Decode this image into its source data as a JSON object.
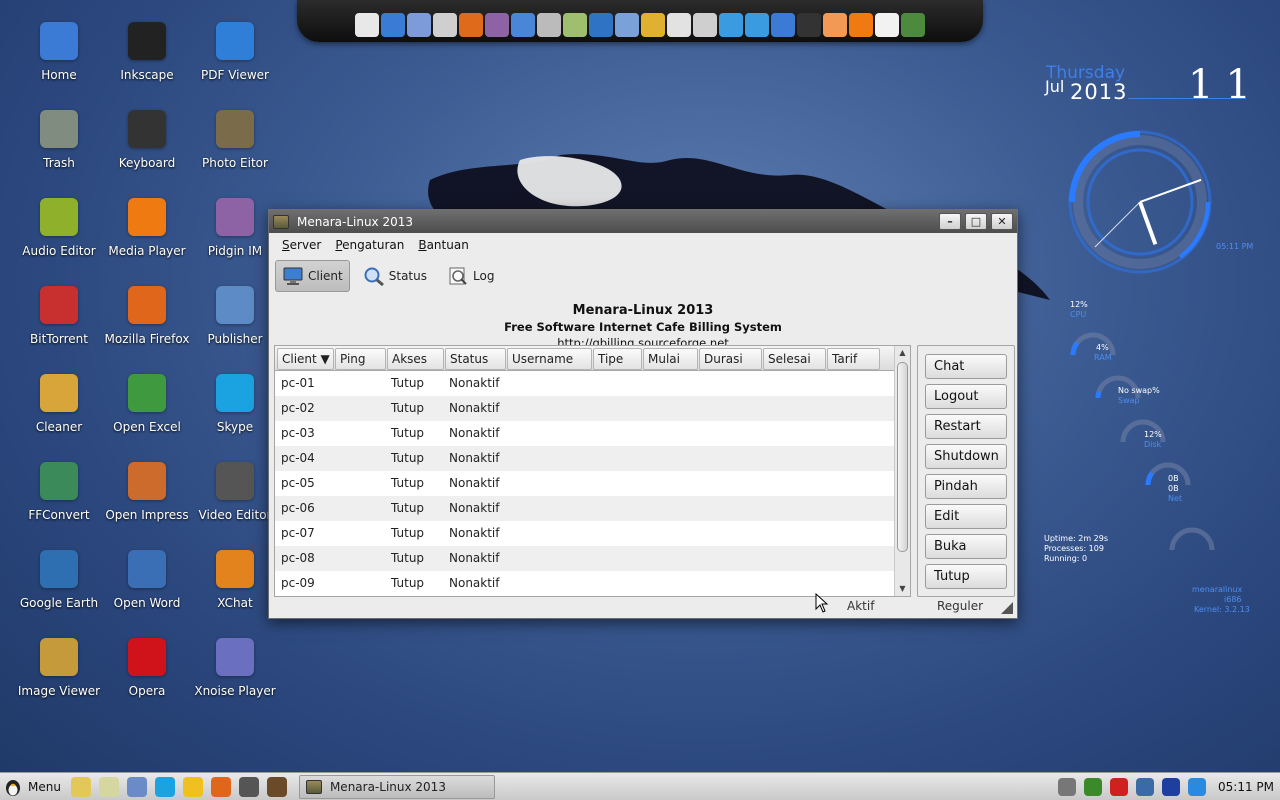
{
  "desktop": {
    "icons": [
      {
        "label": "Home",
        "icon": "home-icon",
        "color": "#3b7bd6"
      },
      {
        "label": "Inkscape",
        "icon": "inkscape-icon",
        "color": "#222222"
      },
      {
        "label": "PDF Viewer",
        "icon": "pdf-icon",
        "color": "#2f7fd8"
      },
      {
        "label": "Trash",
        "icon": "trash-icon",
        "color": "#7f8c7f"
      },
      {
        "label": "Keyboard",
        "icon": "keyboard-icon",
        "color": "#333333"
      },
      {
        "label": "Photo Eitor",
        "icon": "gimp-icon",
        "color": "#7a6b4a"
      },
      {
        "label": "Audio Editor",
        "icon": "music-note-icon",
        "color": "#8fb02a"
      },
      {
        "label": "Media Player",
        "icon": "vlc-cone-icon",
        "color": "#f07a12"
      },
      {
        "label": "Pidgin IM",
        "icon": "pidgin-icon",
        "color": "#8e63a6"
      },
      {
        "label": "BitTorrent",
        "icon": "torrent-icon",
        "color": "#c83030"
      },
      {
        "label": "Mozilla Firefox",
        "icon": "firefox-icon",
        "color": "#e0661c"
      },
      {
        "label": "Publisher",
        "icon": "publisher-icon",
        "color": "#5d8bc6"
      },
      {
        "label": "Cleaner",
        "icon": "broom-icon",
        "color": "#d7a53a"
      },
      {
        "label": "Open Excel",
        "icon": "spreadsheet-icon",
        "color": "#3f9a3f"
      },
      {
        "label": "Skype",
        "icon": "skype-icon",
        "color": "#1aa3e0"
      },
      {
        "label": "FFConvert",
        "icon": "film-convert-icon",
        "color": "#3a8a5a"
      },
      {
        "label": "Open Impress",
        "icon": "presentation-icon",
        "color": "#cc6b2c"
      },
      {
        "label": "Video Editor",
        "icon": "clapperboard-icon",
        "color": "#555555"
      },
      {
        "label": "Google Earth",
        "icon": "globe-icon",
        "color": "#2d6fb0"
      },
      {
        "label": "Open Word",
        "icon": "document-icon",
        "color": "#3b6fb5"
      },
      {
        "label": "XChat",
        "icon": "xchat-icon",
        "color": "#e2831d"
      },
      {
        "label": "Image Viewer",
        "icon": "image-icon",
        "color": "#c59a3a"
      },
      {
        "label": "Opera",
        "icon": "opera-icon",
        "color": "#d0121b"
      },
      {
        "label": "Xnoise Player",
        "icon": "xnoise-icon",
        "color": "#6a6fc0"
      }
    ]
  },
  "dock": {
    "items": [
      "printer-icon",
      "accessibility-icon",
      "calculator-icon",
      "disc-icon",
      "firefox-icon",
      "pidgin-icon",
      "home-icon",
      "copy-icon",
      "download-folder-icon",
      "monitor-icon",
      "search-icon",
      "bug-icon",
      "ftp-icon",
      "archive-download-icon",
      "dropbox-icon",
      "dropbox-icon",
      "help-icon",
      "terminal-icon",
      "shell-icon",
      "vlc-cone-icon",
      "disk-icon",
      "app-icon"
    ],
    "colors": [
      "#e8e8e8",
      "#3a7bd5",
      "#7d9bd8",
      "#cfcfcf",
      "#e06a1c",
      "#8e63a6",
      "#4a86d8",
      "#bbbbbb",
      "#9fbf6f",
      "#2f73c5",
      "#7aa2d9",
      "#e0b030",
      "#e2e2e2",
      "#cfcfcf",
      "#3b9be0",
      "#3b9be0",
      "#3b7bd6",
      "#333333",
      "#f29a55",
      "#f07a12",
      "#f2f2f2",
      "#4e8a3e"
    ]
  },
  "conky": {
    "day": "Thursday",
    "month": "Jul",
    "year": "2013",
    "date": "11",
    "time_small": "05:11 PM",
    "cpu_pct": "12%",
    "cpu_label": "CPU",
    "ram_pct": "4%",
    "ram_label": "RAM",
    "swap_pct": "No swap%",
    "swap_label": "Swap",
    "disk_pct": "12%",
    "disk_label": "Disk",
    "net_up": "0B",
    "net_down": "0B",
    "net_label": "Net",
    "uptime": "Uptime: 2m 29s",
    "processes": "Processes: 109",
    "running": "Running: 0",
    "host": "menaralinux",
    "arch": "i686",
    "kernel": "Kernel: 3.2.13",
    "clock_hour_angle": 160,
    "clock_min_angle": 70
  },
  "window": {
    "title": "Menara-Linux 2013",
    "menu": [
      "Server",
      "Pengaturan",
      "Bantuan"
    ],
    "toolbar": {
      "client": "Client",
      "status": "Status",
      "log": "Log"
    },
    "brand": {
      "title": "Menara-Linux 2013",
      "subtitle": "Free Software Internet Cafe Billing System",
      "url": "http://gbilling.sourceforge.net"
    },
    "columns": [
      "Client ▼",
      "Ping",
      "Akses",
      "Status",
      "Username",
      "Tipe",
      "Mulai",
      "Durasi",
      "Selesai",
      "Tarif"
    ],
    "rows": [
      [
        "pc-01",
        "",
        "Tutup",
        "Nonaktif",
        "",
        "",
        "",
        "",
        "",
        ""
      ],
      [
        "pc-02",
        "",
        "Tutup",
        "Nonaktif",
        "",
        "",
        "",
        "",
        "",
        ""
      ],
      [
        "pc-03",
        "",
        "Tutup",
        "Nonaktif",
        "",
        "",
        "",
        "",
        "",
        ""
      ],
      [
        "pc-04",
        "",
        "Tutup",
        "Nonaktif",
        "",
        "",
        "",
        "",
        "",
        ""
      ],
      [
        "pc-05",
        "",
        "Tutup",
        "Nonaktif",
        "",
        "",
        "",
        "",
        "",
        ""
      ],
      [
        "pc-06",
        "",
        "Tutup",
        "Nonaktif",
        "",
        "",
        "",
        "",
        "",
        ""
      ],
      [
        "pc-07",
        "",
        "Tutup",
        "Nonaktif",
        "",
        "",
        "",
        "",
        "",
        ""
      ],
      [
        "pc-08",
        "",
        "Tutup",
        "Nonaktif",
        "",
        "",
        "",
        "",
        "",
        ""
      ],
      [
        "pc-09",
        "",
        "Tutup",
        "Nonaktif",
        "",
        "",
        "",
        "",
        "",
        ""
      ]
    ],
    "actions": [
      "Chat",
      "Logout",
      "Restart",
      "Shutdown",
      "Pindah",
      "Edit",
      "Buka",
      "Tutup"
    ],
    "status_left": "Aktif",
    "status_right": "Reguler"
  },
  "panel": {
    "menu_label": "Menu",
    "launchers": [
      "file-manager-icon",
      "folder-icon",
      "calculator-icon",
      "skype-icon",
      "emoticon-icon",
      "firefox-icon",
      "clapperboard-icon",
      "speaker-icon"
    ],
    "launcher_colors": [
      "#e2c85a",
      "#d6d6a0",
      "#6b8bc8",
      "#1aa3e0",
      "#f0c020",
      "#e0661c",
      "#555555",
      "#6b4a2a"
    ],
    "task_title": "Menara-Linux 2013",
    "tray": [
      "volume-icon",
      "monitor-green-icon",
      "no-entry-icon",
      "network-icon",
      "battery-icon",
      "power-icon"
    ],
    "tray_colors": [
      "#777777",
      "#3a8a2a",
      "#d02020",
      "#3a6aa8",
      "#1f3fa0",
      "#2a8ae0"
    ],
    "clock": "05:11 PM"
  }
}
